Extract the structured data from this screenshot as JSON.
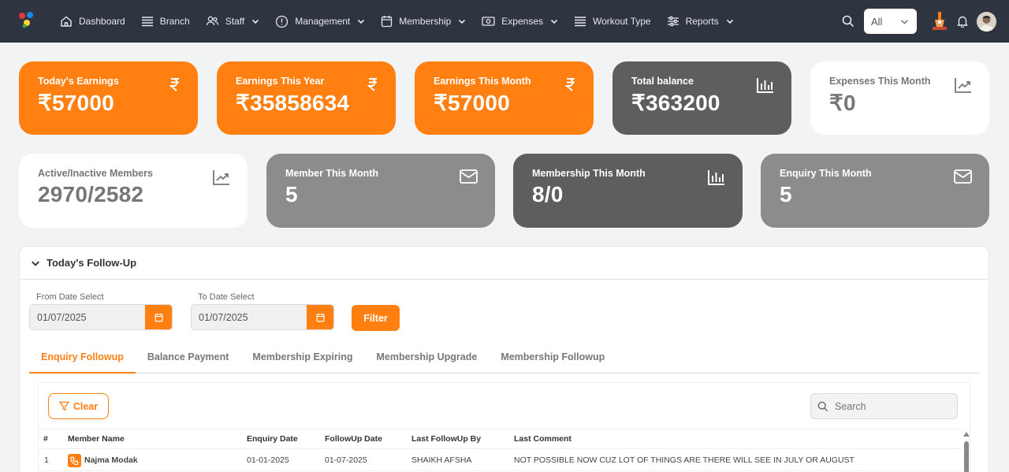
{
  "nav": {
    "items": [
      {
        "label": "Dashboard",
        "icon": "home-icon",
        "dropdown": false
      },
      {
        "label": "Branch",
        "icon": "list-icon",
        "dropdown": false
      },
      {
        "label": "Staff",
        "icon": "users-icon",
        "dropdown": true
      },
      {
        "label": "Management",
        "icon": "alert-circle-icon",
        "dropdown": true
      },
      {
        "label": "Membership",
        "icon": "calendar-icon",
        "dropdown": true
      },
      {
        "label": "Expenses",
        "icon": "money-icon",
        "dropdown": true
      },
      {
        "label": "Workout Type",
        "icon": "list-icon",
        "dropdown": false
      },
      {
        "label": "Reports",
        "icon": "sliders-icon",
        "dropdown": true
      }
    ],
    "branch_select": "All"
  },
  "cards_row1": [
    {
      "label": "Today's Earnings",
      "value": "₹57000",
      "icon": "rupee-icon",
      "style": "orange"
    },
    {
      "label": "Earnings This Year",
      "value": "₹35858634",
      "icon": "rupee-icon",
      "style": "orange"
    },
    {
      "label": "Earnings This Month",
      "value": "₹57000",
      "icon": "rupee-icon",
      "style": "orange"
    },
    {
      "label": "Total balance",
      "value": "₹363200",
      "icon": "bar-chart-icon",
      "style": "dark"
    },
    {
      "label": "Expenses This Month",
      "value": "₹0",
      "icon": "trending-up-icon",
      "style": "white"
    }
  ],
  "cards_row2": [
    {
      "label": "Active/Inactive Members",
      "value": "2970/2582",
      "icon": "trending-up-icon",
      "style": "white"
    },
    {
      "label": "Member This Month",
      "value": "5",
      "icon": "mail-icon",
      "style": "grey"
    },
    {
      "label": "Membership This Month",
      "value": "8/0",
      "icon": "bar-chart-icon",
      "style": "dark"
    },
    {
      "label": "Enquiry This Month",
      "value": "5",
      "icon": "mail-icon",
      "style": "grey"
    }
  ],
  "followup": {
    "title": "Today's Follow-Up",
    "from_label": "From Date Select",
    "from_value": "01/07/2025",
    "to_label": "To Date Select",
    "to_value": "01/07/2025",
    "filter_label": "Filter",
    "tabs": [
      "Enquiry Followup",
      "Balance Payment",
      "Membership Expiring",
      "Membership Upgrade",
      "Membership Followup"
    ],
    "active_tab": "Enquiry Followup",
    "clear_label": "Clear",
    "search_placeholder": "Search",
    "columns": [
      "#",
      "Member Name",
      "Enquiry Date",
      "FollowUp Date",
      "Last FollowUp By",
      "Last Comment"
    ],
    "rows": [
      [
        "1",
        "Najma Modak",
        "01-01-2025",
        "01-07-2025",
        "SHAIKH AFSHA",
        "NOT POSSIBLE NOW CUZ LOT OF THINGS ARE THERE WILL SEE IN JULY OR AUGUST"
      ]
    ]
  },
  "colors": {
    "accent": "#ff7f11",
    "nav_bg": "#2e3440",
    "dark_card": "#5e5e5e",
    "grey_card": "#8c8c8c"
  }
}
